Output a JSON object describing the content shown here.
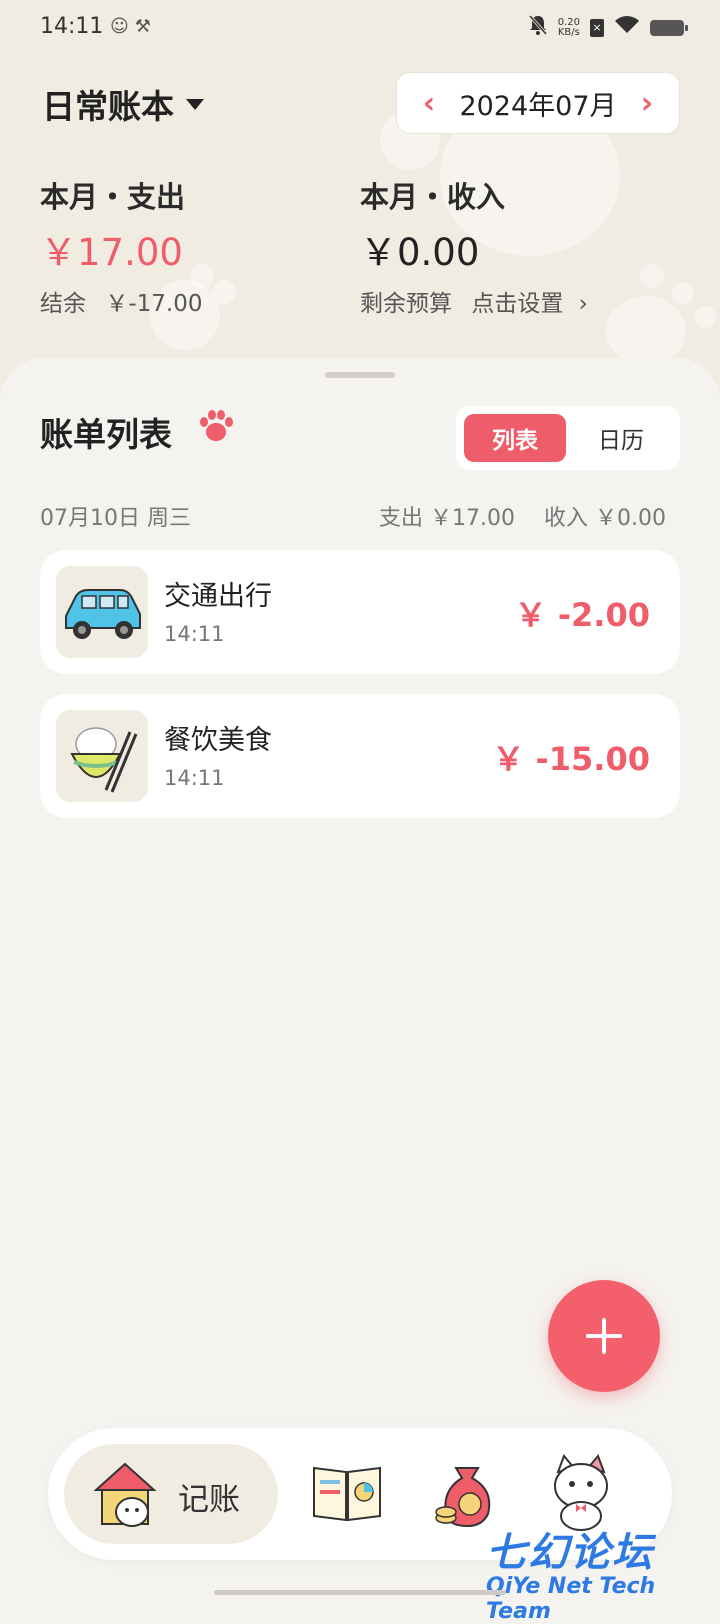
{
  "status_bar": {
    "time": "14:11",
    "left_icons": [
      "app-notification-icon",
      "tools-icon"
    ],
    "net_speed_value": "0.20",
    "net_speed_unit": "KB/s",
    "right_icons": [
      "mute-icon",
      "sim-off-icon",
      "wifi-icon",
      "battery-icon"
    ]
  },
  "header": {
    "book_name": "日常账本",
    "month_label": "2024年07月",
    "prev_arrow": "‹",
    "next_arrow": "›"
  },
  "summary": {
    "expense_label": "本月・支出",
    "expense_value": "￥17.00",
    "income_label": "本月・收入",
    "income_value": "￥0.00",
    "balance_label": "结余",
    "balance_value": "￥-17.00",
    "budget_label": "剩余预算",
    "budget_action": "点击设置",
    "chevron": "›"
  },
  "sheet": {
    "title": "账单列表",
    "toggle": [
      "列表",
      "日历"
    ],
    "day": {
      "date": "07月10日 周三",
      "expense": "支出 ￥17.00",
      "income": "收入 ￥0.00"
    },
    "records": [
      {
        "category": "交通出行",
        "time": "14:11",
        "amount": "￥ -2.00",
        "icon": "car-icon"
      },
      {
        "category": "餐饮美食",
        "time": "14:11",
        "amount": "￥ -15.00",
        "icon": "rice-bowl-icon"
      }
    ]
  },
  "bottom_nav": {
    "active_label": "记账",
    "items": [
      "home-cat-icon",
      "book-chart-icon",
      "money-bag-icon",
      "cat-profile-icon"
    ]
  },
  "watermark": {
    "cn": "七幻论坛",
    "en": "QiYe Net Tech Team"
  },
  "colors": {
    "accent": "#ef5d6a",
    "background": "#f5f3ef",
    "header_bg": "#f1ece2"
  }
}
